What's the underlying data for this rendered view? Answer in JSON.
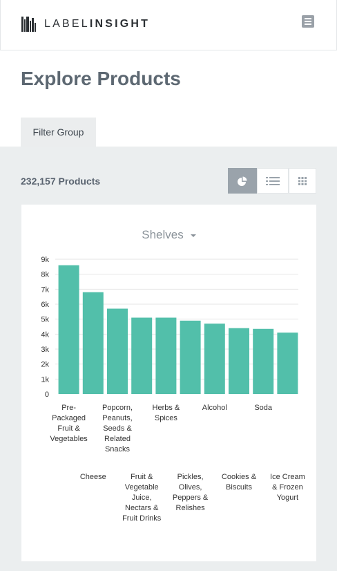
{
  "header": {
    "logo_text_light": "LABEL",
    "logo_text_bold": "INSIGHT",
    "menu_icon": "hamburger-icon"
  },
  "page": {
    "title": "Explore Products"
  },
  "tabs": [
    {
      "label": "Filter Group"
    }
  ],
  "results": {
    "count_label": "232,157 Products"
  },
  "view_toggle": [
    {
      "icon": "pie-chart-icon",
      "active": true
    },
    {
      "icon": "list-icon",
      "active": false
    },
    {
      "icon": "grid-icon",
      "active": false
    }
  ],
  "colors": {
    "bar": "#52bfaa",
    "accent": "#9aa3ab"
  },
  "chart_data": {
    "type": "bar",
    "title": "Shelves",
    "categories": [
      "Pre-Packaged Fruit & Vegetables",
      "Cheese",
      "Popcorn, Peanuts, Seeds & Related Snacks",
      "Fruit & Vegetable Juice, Nectars & Fruit Drinks",
      "Herbs & Spices",
      "Pickles, Olives, Peppers & Relishes",
      "Alcohol",
      "Cookies & Biscuits",
      "Soda",
      "Ice Cream & Frozen Yogurt"
    ],
    "values": [
      8600,
      6800,
      5700,
      5100,
      5100,
      4900,
      4700,
      4400,
      4350,
      4100
    ],
    "yticks": [
      "0",
      "1k",
      "2k",
      "3k",
      "4k",
      "5k",
      "6k",
      "7k",
      "8k",
      "9k"
    ],
    "ylim": [
      0,
      9000
    ],
    "grid": true
  }
}
